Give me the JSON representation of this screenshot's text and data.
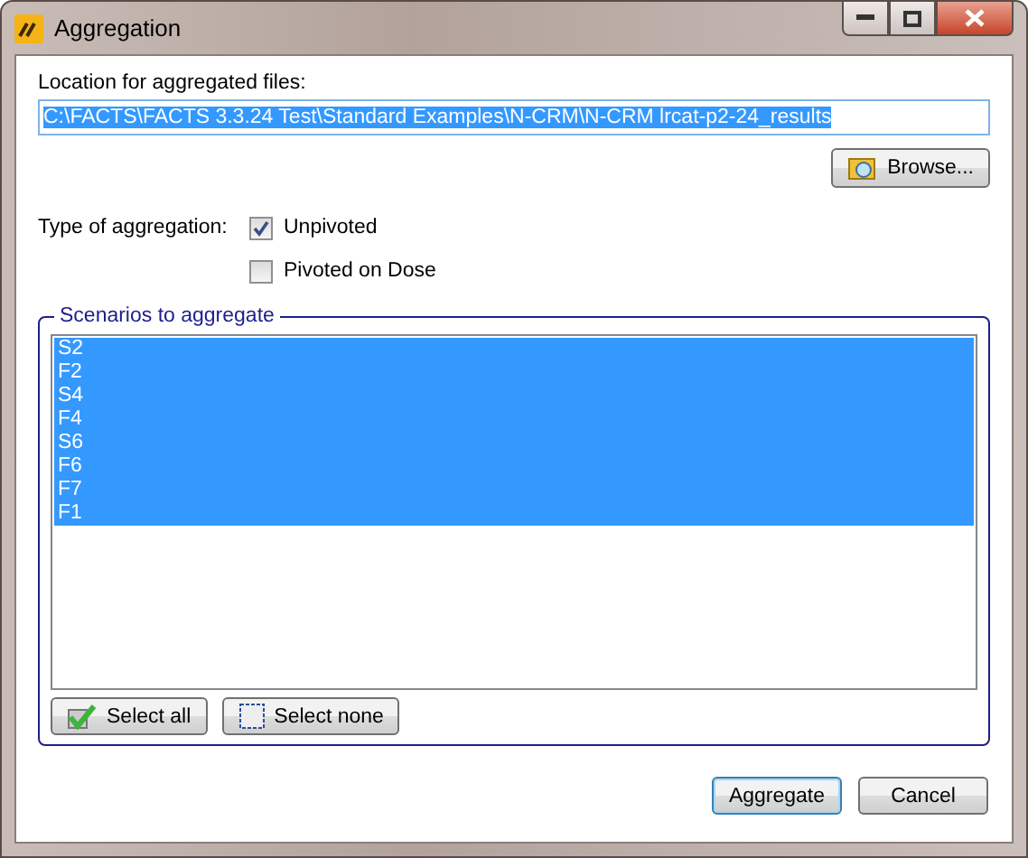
{
  "window": {
    "title": "Aggregation"
  },
  "location": {
    "label": "Location for aggregated files:",
    "value": "C:\\FACTS\\FACTS 3.3.24 Test\\Standard Examples\\N-CRM\\N-CRM lrcat-p2-24_results",
    "browse_button": "Browse..."
  },
  "aggregation_type": {
    "label": "Type of aggregation:",
    "options": [
      {
        "label": "Unpivoted",
        "checked": true
      },
      {
        "label": "Pivoted on Dose",
        "checked": false
      }
    ]
  },
  "scenarios": {
    "title": "Scenarios to aggregate",
    "items": [
      {
        "label": "S2",
        "selected": true
      },
      {
        "label": "F2",
        "selected": true
      },
      {
        "label": "S4",
        "selected": true
      },
      {
        "label": "F4",
        "selected": true
      },
      {
        "label": "S6",
        "selected": true
      },
      {
        "label": "F6",
        "selected": true
      },
      {
        "label": "F7",
        "selected": true
      },
      {
        "label": "F1",
        "selected": true
      }
    ],
    "select_all": "Select all",
    "select_none": "Select none"
  },
  "buttons": [
    {
      "label": "Aggregate",
      "focused": true
    },
    {
      "label": "Cancel",
      "focused": false
    }
  ]
}
